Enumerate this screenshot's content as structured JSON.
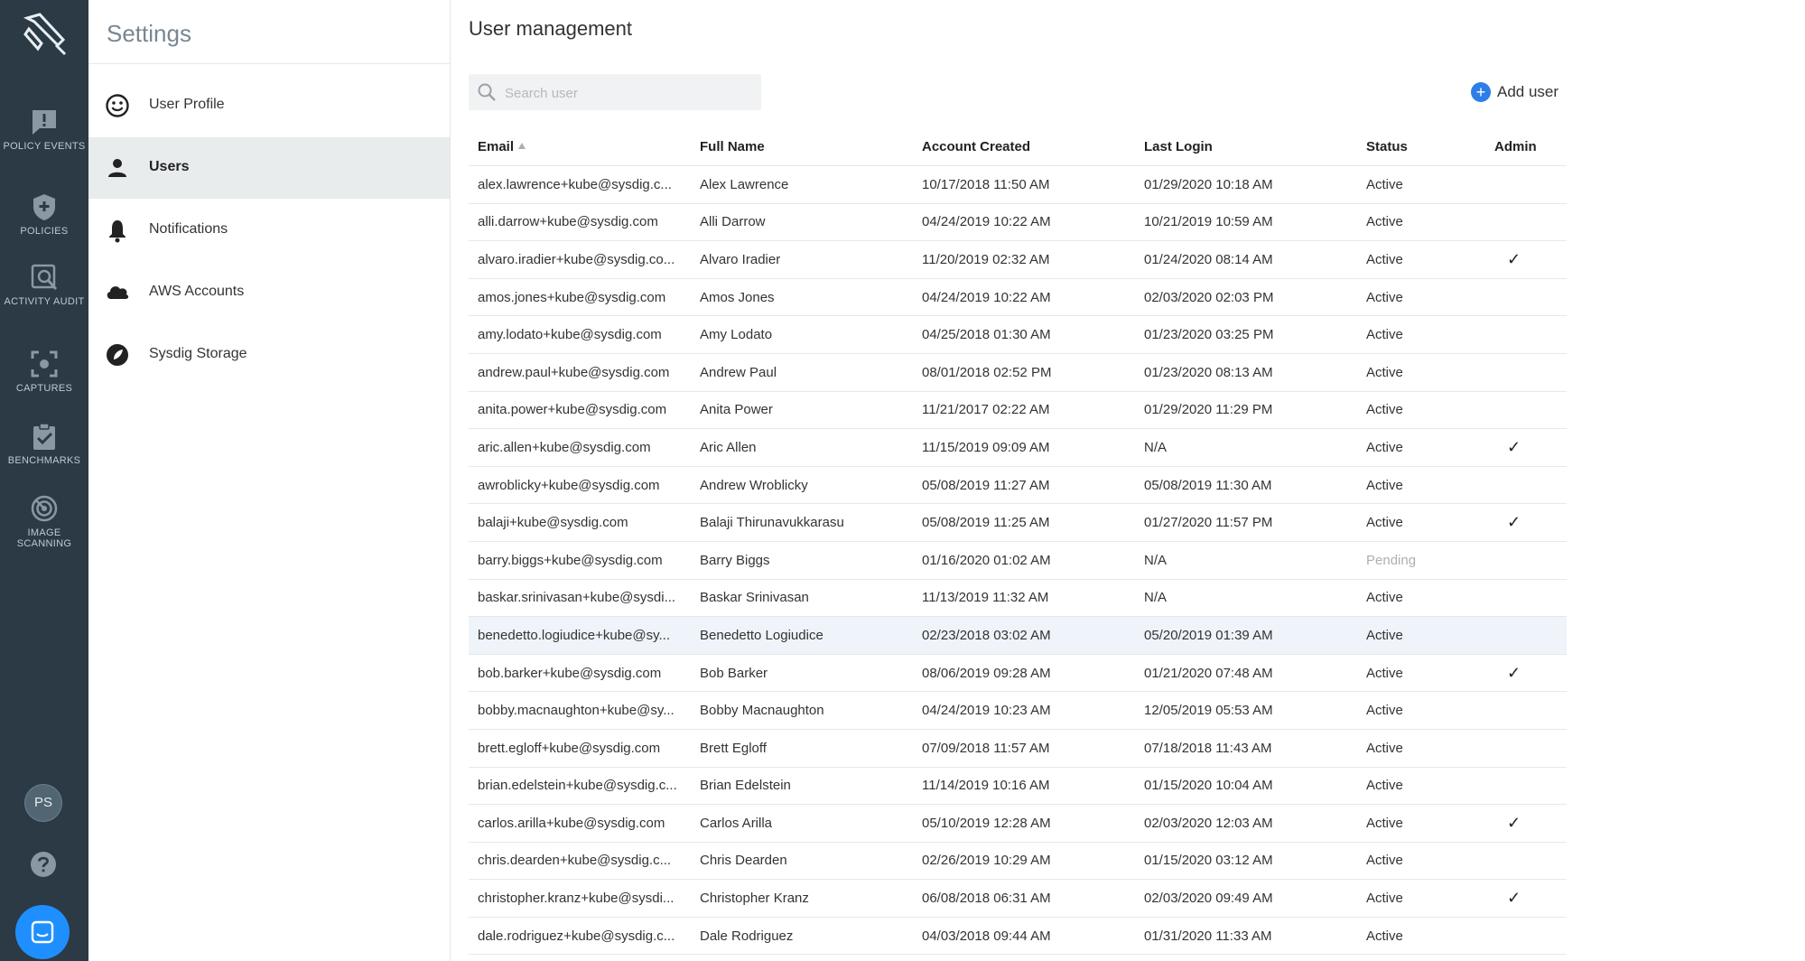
{
  "rail": {
    "items": [
      {
        "label": "POLICY EVENTS",
        "icon": "policy-events-icon"
      },
      {
        "label": "POLICIES",
        "icon": "shield-icon"
      },
      {
        "label": "ACTIVITY AUDIT",
        "icon": "activity-audit-icon"
      },
      {
        "label": "CAPTURES",
        "icon": "captures-icon"
      },
      {
        "label": "BENCHMARKS",
        "icon": "benchmarks-icon"
      },
      {
        "label": "IMAGE SCANNING",
        "icon": "image-scanning-icon"
      }
    ],
    "avatar_initials": "PS"
  },
  "settings": {
    "title": "Settings",
    "nav": [
      {
        "label": "User Profile",
        "icon": "smiley-icon",
        "active": false
      },
      {
        "label": "Users",
        "icon": "person-icon",
        "active": true
      },
      {
        "label": "Notifications",
        "icon": "bell-icon",
        "active": false
      },
      {
        "label": "AWS Accounts",
        "icon": "cloud-icon",
        "active": false
      },
      {
        "label": "Sysdig Storage",
        "icon": "storage-icon",
        "active": false
      }
    ]
  },
  "main": {
    "title": "User management",
    "search_placeholder": "Search user",
    "add_user_label": "Add user",
    "columns": [
      "Email",
      "Full Name",
      "Account Created",
      "Last Login",
      "Status",
      "Admin"
    ],
    "rows": [
      {
        "email": "alex.lawrence+kube@sysdig.c...",
        "name": "Alex Lawrence",
        "created": "10/17/2018 11:50 AM",
        "login": "01/29/2020 10:18 AM",
        "status": "Active",
        "admin": ""
      },
      {
        "email": "alli.darrow+kube@sysdig.com",
        "name": "Alli Darrow",
        "created": "04/24/2019 10:22 AM",
        "login": "10/21/2019 10:59 AM",
        "status": "Active",
        "admin": ""
      },
      {
        "email": "alvaro.iradier+kube@sysdig.co...",
        "name": "Alvaro Iradier",
        "created": "11/20/2019 02:32 AM",
        "login": "01/24/2020 08:14 AM",
        "status": "Active",
        "admin": "✓"
      },
      {
        "email": "amos.jones+kube@sysdig.com",
        "name": "Amos Jones",
        "created": "04/24/2019 10:22 AM",
        "login": "02/03/2020 02:03 PM",
        "status": "Active",
        "admin": ""
      },
      {
        "email": "amy.lodato+kube@sysdig.com",
        "name": "Amy Lodato",
        "created": "04/25/2018 01:30 AM",
        "login": "01/23/2020 03:25 PM",
        "status": "Active",
        "admin": ""
      },
      {
        "email": "andrew.paul+kube@sysdig.com",
        "name": "Andrew Paul",
        "created": "08/01/2018 02:52 PM",
        "login": "01/23/2020 08:13 AM",
        "status": "Active",
        "admin": ""
      },
      {
        "email": "anita.power+kube@sysdig.com",
        "name": "Anita Power",
        "created": "11/21/2017 02:22 AM",
        "login": "01/29/2020 11:29 PM",
        "status": "Active",
        "admin": ""
      },
      {
        "email": "aric.allen+kube@sysdig.com",
        "name": "Aric Allen",
        "created": "11/15/2019 09:09 AM",
        "login": "N/A",
        "status": "Active",
        "admin": "✓"
      },
      {
        "email": "awroblicky+kube@sysdig.com",
        "name": "Andrew Wroblicky",
        "created": "05/08/2019 11:27 AM",
        "login": "05/08/2019 11:30 AM",
        "status": "Active",
        "admin": ""
      },
      {
        "email": "balaji+kube@sysdig.com",
        "name": "Balaji Thirunavukkarasu",
        "created": "05/08/2019 11:25 AM",
        "login": "01/27/2020 11:57 PM",
        "status": "Active",
        "admin": "✓"
      },
      {
        "email": "barry.biggs+kube@sysdig.com",
        "name": "Barry Biggs",
        "created": "01/16/2020 01:02 AM",
        "login": "N/A",
        "status": "Pending",
        "admin": ""
      },
      {
        "email": "baskar.srinivasan+kube@sysdi...",
        "name": "Baskar Srinivasan",
        "created": "11/13/2019 11:32 AM",
        "login": "N/A",
        "status": "Active",
        "admin": ""
      },
      {
        "email": "benedetto.logiudice+kube@sy...",
        "name": "Benedetto Logiudice",
        "created": "02/23/2018 03:02 AM",
        "login": "05/20/2019 01:39 AM",
        "status": "Active",
        "admin": ""
      },
      {
        "email": "bob.barker+kube@sysdig.com",
        "name": "Bob Barker",
        "created": "08/06/2019 09:28 AM",
        "login": "01/21/2020 07:48 AM",
        "status": "Active",
        "admin": "✓"
      },
      {
        "email": "bobby.macnaughton+kube@sy...",
        "name": "Bobby Macnaughton",
        "created": "04/24/2019 10:23 AM",
        "login": "12/05/2019 05:53 AM",
        "status": "Active",
        "admin": ""
      },
      {
        "email": "brett.egloff+kube@sysdig.com",
        "name": "Brett Egloff",
        "created": "07/09/2018 11:57 AM",
        "login": "07/18/2018 11:43 AM",
        "status": "Active",
        "admin": ""
      },
      {
        "email": "brian.edelstein+kube@sysdig.c...",
        "name": "Brian Edelstein",
        "created": "11/14/2019 10:16 AM",
        "login": "01/15/2020 10:04 AM",
        "status": "Active",
        "admin": ""
      },
      {
        "email": "carlos.arilla+kube@sysdig.com",
        "name": "Carlos Arilla",
        "created": "05/10/2019 12:28 AM",
        "login": "02/03/2020 12:03 AM",
        "status": "Active",
        "admin": "✓"
      },
      {
        "email": "chris.dearden+kube@sysdig.c...",
        "name": "Chris Dearden",
        "created": "02/26/2019 10:29 AM",
        "login": "01/15/2020 03:12 AM",
        "status": "Active",
        "admin": ""
      },
      {
        "email": "christopher.kranz+kube@sysdi...",
        "name": "Christopher Kranz",
        "created": "06/08/2018 06:31 AM",
        "login": "02/03/2020 09:49 AM",
        "status": "Active",
        "admin": "✓"
      },
      {
        "email": "dale.rodriguez+kube@sysdig.c...",
        "name": "Dale Rodriguez",
        "created": "04/03/2018 09:44 AM",
        "login": "01/31/2020 11:33 AM",
        "status": "Active",
        "admin": ""
      }
    ]
  }
}
